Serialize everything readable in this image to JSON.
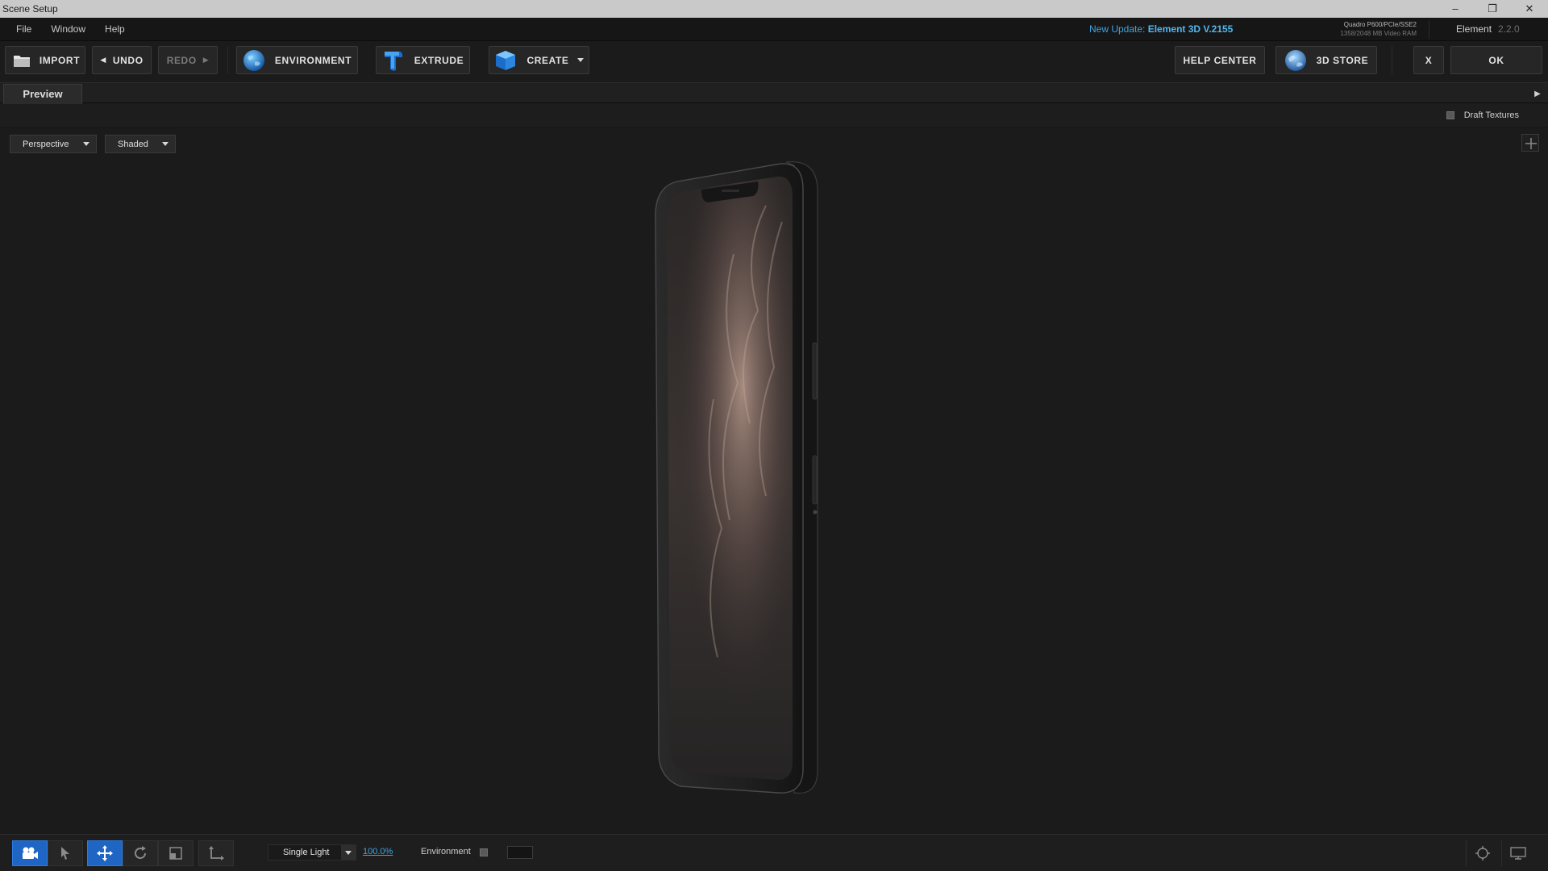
{
  "window": {
    "title": "Scene Setup",
    "controls": [
      "–",
      "❐",
      "✕"
    ]
  },
  "menu": [
    "File",
    "Window",
    "Help"
  ],
  "update": {
    "prefix": "New Update:",
    "version": "Element 3D V.2155"
  },
  "gpu": {
    "name": "Quadro P600/PCIe/SSE2",
    "vram": "1358/2048 MB Video RAM"
  },
  "app": {
    "name": "Element",
    "version": "2.2.0"
  },
  "toolbar": {
    "import": "IMPORT",
    "undo": "UNDO",
    "redo": "REDO",
    "environment": "ENVIRONMENT",
    "extrude": "EXTRUDE",
    "create": "CREATE",
    "help_center": "HELP CENTER",
    "store": "3D STORE",
    "close": "X",
    "ok": "OK"
  },
  "tabs": {
    "preview": "Preview"
  },
  "draft_textures": {
    "label": "Draft Textures",
    "checked": false
  },
  "viewport": {
    "camera": "Perspective",
    "shading": "Shaded"
  },
  "bottom": {
    "light_mode": "Single Light",
    "light_intensity": "100.0%",
    "environment_label": "Environment",
    "active_tool": "move"
  },
  "colors": {
    "accent": "#1f66c4",
    "link": "#3ea4e3",
    "titlebar": "#c9c9c9"
  }
}
